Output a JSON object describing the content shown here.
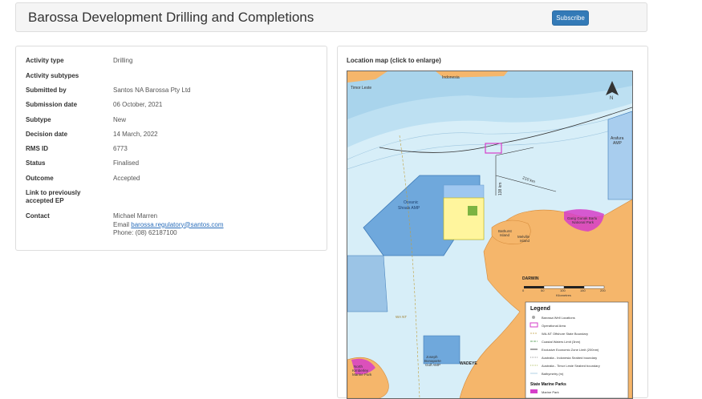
{
  "header": {
    "title": "Barossa Development Drilling and Completions",
    "subscribe_label": "Subscribe"
  },
  "details": [
    {
      "label": "Activity type",
      "value": "Drilling"
    },
    {
      "label": "Activity subtypes",
      "value": ""
    },
    {
      "label": "Submitted by",
      "value": "Santos NA Barossa Pty Ltd"
    },
    {
      "label": "Submission date",
      "value": "06 October, 2021"
    },
    {
      "label": "Subtype",
      "value": "New"
    },
    {
      "label": "Decision date",
      "value": "14 March, 2022"
    },
    {
      "label": "RMS ID",
      "value": "6773"
    },
    {
      "label": "Status",
      "value": "Finalised"
    },
    {
      "label": "Outcome",
      "value": "Accepted"
    },
    {
      "label": "Link to previously accepted EP",
      "value": ""
    }
  ],
  "contact": {
    "label": "Contact",
    "name": "Michael Marren",
    "email_prefix": "Email",
    "email": "barossa.regulatory@santos.com",
    "phone": "Phone: (08) 62187100"
  },
  "map": {
    "caption": "Location map (click to enlarge)",
    "labels": {
      "indonesia": "Indonesia",
      "timor_leste": "Timor Leste",
      "arafura": "Arafura",
      "arafura2": "AMP",
      "oceanic1": "Oceanic",
      "oceanic2": "Shoals AMP",
      "km210": "210 km",
      "km138": "138 km",
      "bathurst1": "Bathurst",
      "bathurst2": "Island",
      "melville1": "Melville",
      "melville2": "Island",
      "garig1": "Garig Gunak Barlu",
      "garig2": "National Park",
      "darwin": "DARWIN",
      "wadeye": "WADEYE",
      "joseph1": "Joseph",
      "joseph2": "Bonaparte",
      "joseph3": "Gulf AMP",
      "north1": "North",
      "north2": "Kimberley",
      "north3": "Marine Park",
      "wa_nt": "WA NT",
      "north_arrow": "N",
      "scale_0": "0",
      "scale_50": "50",
      "scale_100": "100",
      "scale_150": "150",
      "scale_200": "200",
      "scale_unit": "Kilometres"
    },
    "legend": {
      "title": "Legend",
      "items": [
        "Barossa Well Locations",
        "Operational Area",
        "WA-NT Offshore State Boundary",
        "Coastal Waters Limit (3nm)",
        "Exclusive Economic Zone Limit (200nm)",
        "Australia - Indonesia Seabed boundary",
        "Australia - Timor Leste Seabed boundary",
        "Bathymetry (m)"
      ],
      "section": "State Marine Parks",
      "section_item": "Marine Park"
    },
    "colors": {
      "ocean": "#d7eef8",
      "deep": "#bde0f2",
      "land": "#f5b66b",
      "amp": "#6fa8dc",
      "operational": "#fff59d",
      "park": "#d63ec9"
    }
  }
}
